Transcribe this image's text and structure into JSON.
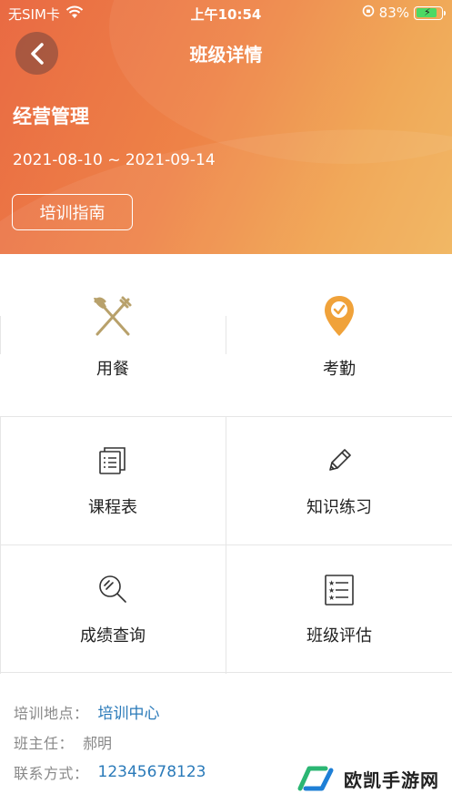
{
  "status_bar": {
    "carrier": "无SIM卡",
    "time": "上午10:54",
    "battery": "83%",
    "battery_level": 0.83
  },
  "nav": {
    "title": "班级详情",
    "back_icon": "chevron-left-icon"
  },
  "class_info": {
    "name": "经营管理",
    "dates": "2021-08-10 ~ 2021-09-14",
    "guide_button": "培训指南"
  },
  "quick_actions": [
    {
      "label": "用餐",
      "icon": "fork-knife-icon"
    },
    {
      "label": "考勤",
      "icon": "location-check-icon"
    }
  ],
  "grid": [
    {
      "label": "课程表",
      "icon": "schedule-icon"
    },
    {
      "label": "知识练习",
      "icon": "pencil-icon"
    },
    {
      "label": "成绩查询",
      "icon": "magnifier-icon"
    },
    {
      "label": "班级评估",
      "icon": "checklist-icon"
    }
  ],
  "details": {
    "location_label": "培训地点：",
    "location_value": "培训中心",
    "teacher_label": "班主任：",
    "teacher_value": "郝明",
    "contact_label": "联系方式：",
    "contact_value": "12345678123"
  },
  "watermark": {
    "text": "欧凯手游网"
  },
  "colors": {
    "header_start": "#e96a43",
    "header_end": "#f0b35a",
    "link": "#2a7ab9",
    "icon_gold": "#b8a16b",
    "icon_orange": "#f0a23a"
  }
}
